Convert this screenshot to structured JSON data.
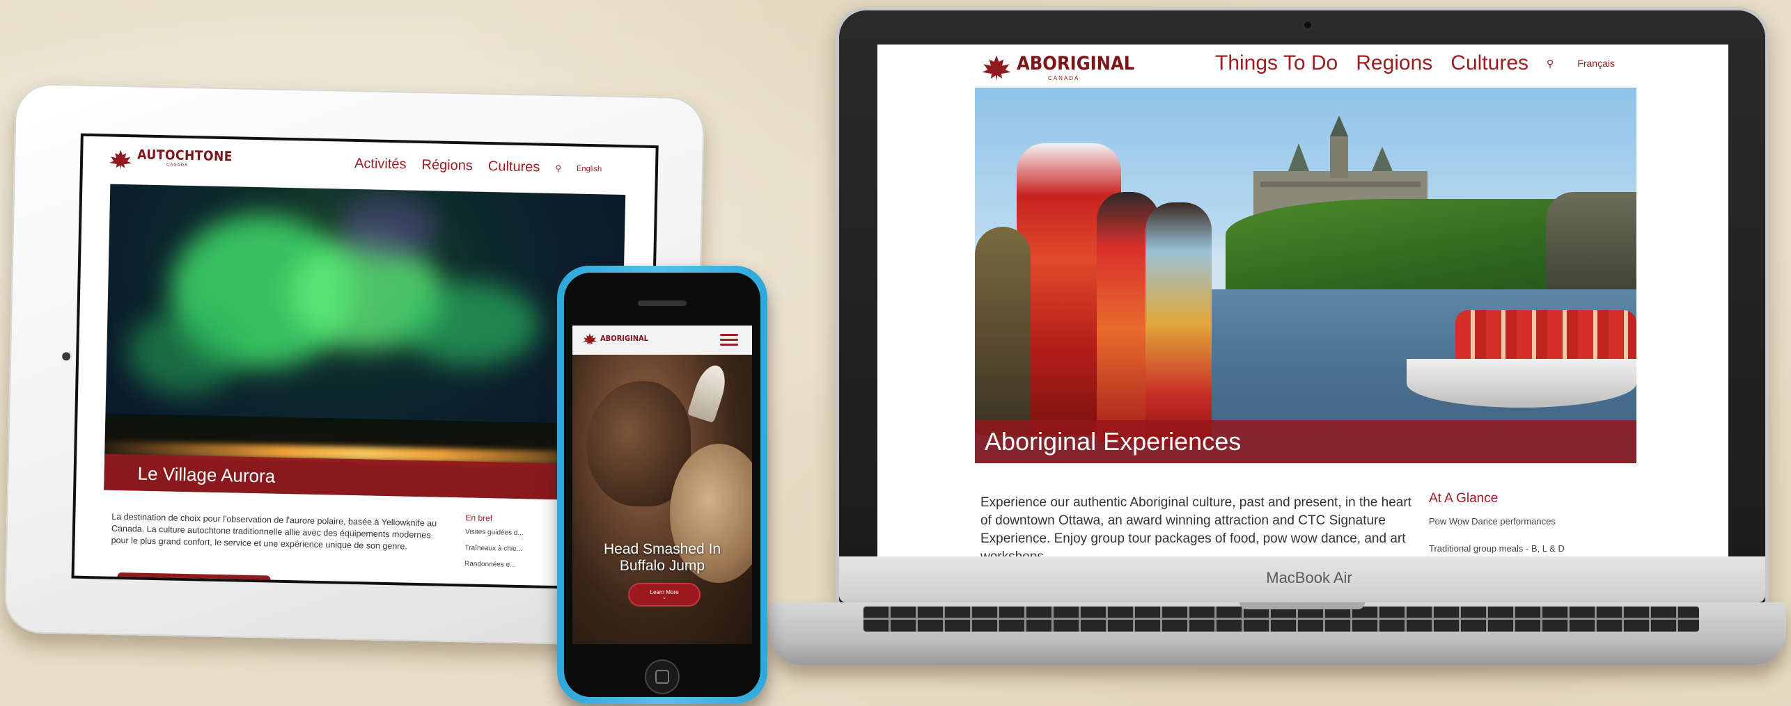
{
  "colors": {
    "brand_red": "#a01c22",
    "background": "#e9dfc9",
    "phone_body": "#2ea7da"
  },
  "tablet": {
    "logo_text": "AUTOCHTONE",
    "logo_subtext": "CANADA",
    "nav": [
      {
        "label": "Activités"
      },
      {
        "label": "Régions"
      },
      {
        "label": "Cultures"
      }
    ],
    "language_link": "English",
    "hero_title": "Le Village Aurora",
    "body_text": "La destination de choix pour l'observation de l'aurore polaire, basée à Yellowknife au Canada. La culture autochtone traditionnelle allie avec des équipements modernes pour le plus grand confort, le service et une expérience unique de son genre.",
    "sidebar_title": "En bref",
    "sidebar_items": [
      "Visites guidées d...",
      "Traîneaux à chie...",
      "Randonnées e..."
    ]
  },
  "laptop": {
    "logo_text": "ABORIGINAL",
    "logo_subtext": "CANADA",
    "nav": [
      {
        "label": "Things To Do"
      },
      {
        "label": "Regions"
      },
      {
        "label": "Cultures"
      }
    ],
    "language_link": "Français",
    "hero_title": "Aboriginal Experiences",
    "body_text": "Experience our authentic Aboriginal culture, past and present, in the heart of downtown Ottawa, an award winning attraction and CTC Signature Experience. Enjoy group tour packages of food, pow wow dance, and art workshops.",
    "sidebar_title": "At A Glance",
    "sidebar_items": [
      "Pow Wow Dance performances",
      "Traditional group meals - B, L & D"
    ],
    "brand_label": "MacBook Air"
  },
  "phone": {
    "logo_text": "ABORIGINAL",
    "hero_title_line1": "Head Smashed In",
    "hero_title_line2": "Buffalo Jump",
    "button_label": "Learn More",
    "button_arrow": "⌄"
  },
  "icons": {
    "search": "⚲"
  }
}
